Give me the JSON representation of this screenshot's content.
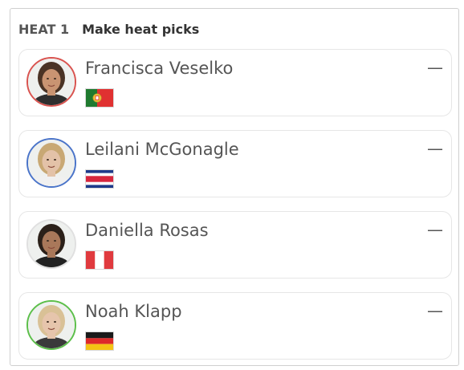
{
  "heat": {
    "label": "HEAT 1",
    "action": "Make heat picks"
  },
  "surfers": [
    {
      "name": "Francisca Veselko",
      "pick": "—",
      "country_flag": "portugal-flag",
      "ring_color": "#d9534f",
      "skin": "#c99472",
      "hair": "#4a3325",
      "shirt": "#2f2f2f"
    },
    {
      "name": "Leilani McGonagle",
      "pick": "—",
      "country_flag": "costa-rica-flag",
      "ring_color": "#4a74c9",
      "skin": "#e3c2a8",
      "hair": "#c8a874",
      "shirt": "#f0f0f0"
    },
    {
      "name": "Daniella Rosas",
      "pick": "—",
      "country_flag": "peru-flag",
      "ring_color": "#e0e0e0",
      "skin": "#a9785a",
      "hair": "#2b2019",
      "shirt": "#222222"
    },
    {
      "name": "Noah Klapp",
      "pick": "—",
      "country_flag": "germany-flag",
      "ring_color": "#5cbf4a",
      "skin": "#e6c5ac",
      "hair": "#d9c196",
      "shirt": "#3a3a3a"
    }
  ]
}
